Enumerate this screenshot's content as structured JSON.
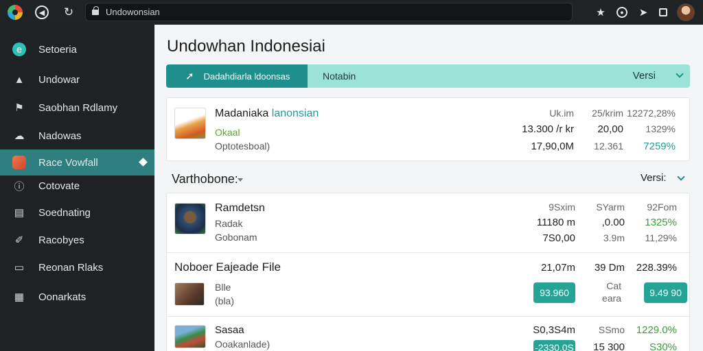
{
  "browser": {
    "url": "Undowonsian",
    "icons": [
      "app-logo-icon",
      "back-icon",
      "reload-icon",
      "lock-icon",
      "star-icon",
      "extension-icon",
      "pin-icon",
      "window-icon",
      "profile-avatar"
    ]
  },
  "sidebar": {
    "items": [
      {
        "label": "Setoeria",
        "icon": "app-icon"
      },
      {
        "label": "Undowar",
        "icon": "home-icon"
      },
      {
        "label": "Saobhan Rdlamy",
        "icon": "flag-icon"
      },
      {
        "label": "Nadowas",
        "icon": "cloud-icon"
      },
      {
        "label": "Race Vowfall",
        "icon": "race-icon",
        "active": true
      },
      {
        "label": "Cotovate",
        "icon": "info-circle-icon"
      },
      {
        "label": "Soednating",
        "icon": "list-icon"
      },
      {
        "label": "Racobyes",
        "icon": "pen-icon"
      },
      {
        "label": "Reonan Rlaks",
        "icon": "window-icon"
      },
      {
        "label": "Oonarkats",
        "icon": "grid-icon"
      }
    ]
  },
  "main": {
    "title": "Undowhan Indonesiai",
    "filter": {
      "segment_label": "Dadahdiarla ldoonsas",
      "label": "Notabin",
      "version_label": "Versi"
    },
    "top_card": {
      "name": "Madaniaka",
      "name_accent": "lanonsian",
      "sub1": "Okaal",
      "sub2": "Optotesboal)",
      "col1": [
        "Uk.im",
        "13.300 /r kr",
        "17,90,0M"
      ],
      "col2": [
        "25/krim",
        "20,00",
        "12.361"
      ],
      "col3": [
        "12272,28%",
        "1329%",
        "7259%"
      ]
    },
    "section": {
      "title": "Varthobone:",
      "version_label": "Versi:"
    },
    "list": [
      {
        "name": "Ramdetsn",
        "sub1": "Radak",
        "sub2": "Gobonam",
        "col1": [
          "9Sxim",
          "11180 m",
          "7S0,00"
        ],
        "col2": [
          "SYarm",
          ",0.00",
          "3.9m"
        ],
        "col3": [
          "92Fom",
          "1325%",
          "11,29%"
        ]
      },
      {
        "name": "Noboer Eajeade File",
        "sub1": "Blle",
        "sub2": "(bla)",
        "col1": [
          "21,07m",
          "93.960"
        ],
        "col2": [
          "39 Dm",
          "Cat",
          "eara"
        ],
        "col3": [
          "228.39%",
          "9.49 90"
        ]
      },
      {
        "name": "Sasaa",
        "sub1": "Ooakanlade)",
        "col1": [
          "S0,3S4m",
          "-2330,0S"
        ],
        "col2": [
          "SSmo",
          "15 300"
        ],
        "col3": [
          "1229.0%",
          "S30%"
        ]
      }
    ]
  },
  "colors": {
    "sidebar_bg": "#1e2225",
    "active_item": "#2f7f80",
    "accent_teal": "#24a396",
    "filter_bg": "#9be3d6",
    "gain_green": "#3b9d3b"
  }
}
